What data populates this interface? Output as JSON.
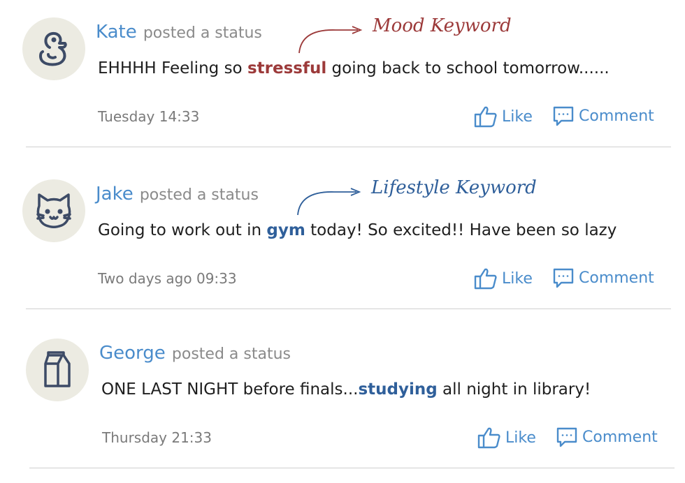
{
  "annotations": {
    "mood": "Mood Keyword",
    "lifestyle": "Lifestyle Keyword"
  },
  "actions": {
    "like": "Like",
    "comment": "Comment"
  },
  "colors": {
    "link": "#4a8ccb",
    "mood": "#9c3a3a",
    "lifestyle": "#2f5f9a",
    "avatar_bg": "#ecebe2"
  },
  "posts": [
    {
      "name": "Kate",
      "action_text": "posted a status",
      "avatar_icon": "duck-icon",
      "text_before": "EHHHH Feeling so ",
      "keyword": "stressful",
      "text_after": " going back to school tomorrow......",
      "time": "Tuesday 14:33"
    },
    {
      "name": "Jake",
      "action_text": "posted a status",
      "avatar_icon": "cat-icon",
      "text_before": "Going to work out in ",
      "keyword": "gym",
      "text_after": " today! So excited!! Have been so lazy",
      "time": "Two days ago 09:33"
    },
    {
      "name": "George",
      "action_text": "posted a status",
      "avatar_icon": "milk-carton-icon",
      "text_before": "ONE LAST NIGHT before finals...",
      "keyword": "studying",
      "text_after": " all night in library!",
      "time": "Thursday 21:33"
    }
  ]
}
